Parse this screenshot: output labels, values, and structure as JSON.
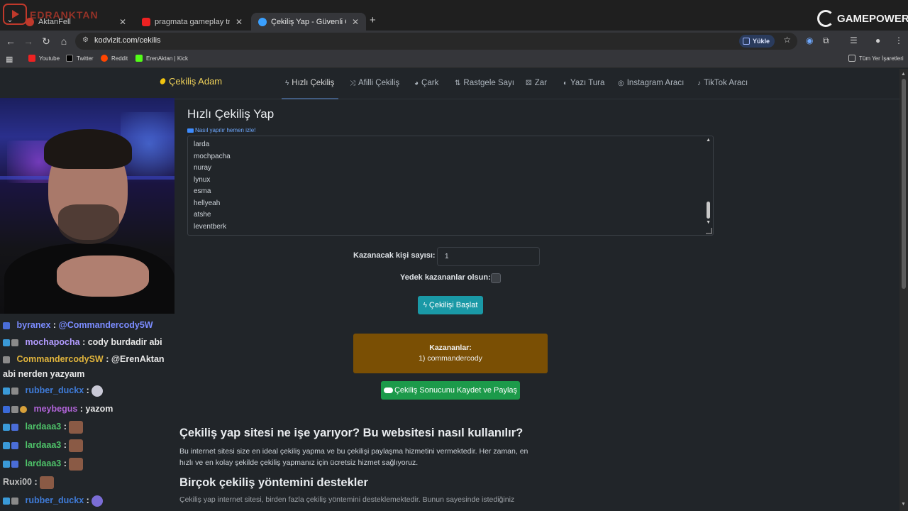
{
  "stream_overlay": {
    "label": "EDRANKTAN"
  },
  "browser": {
    "tabs": [
      {
        "title": "AktanFell",
        "active": false
      },
      {
        "title": "pragmata gameplay trailer - YouTube",
        "active": false
      },
      {
        "title": "Çekiliş Yap - Güvenli Çekiliş - Hızlı",
        "active": true
      }
    ],
    "url": "kodvizit.com/cekilis",
    "upload_label": "Yükle",
    "bookmarks": [
      "Youtube",
      "Twitter",
      "Reddit",
      "ErenAktan | Kick"
    ],
    "all_bookmarks": "Tüm Yer İşaretleri"
  },
  "gamepower_logo": "GAMEPOWER",
  "site": {
    "brand": "Çekiliş Adam",
    "nav": [
      {
        "label": "Hızlı Çekiliş",
        "icon": "bolt-icon"
      },
      {
        "label": "Afilli Çekiliş",
        "icon": "shuffle-icon"
      },
      {
        "label": "Çark",
        "icon": "pie-icon"
      },
      {
        "label": "Rastgele Sayı",
        "icon": "sort-icon"
      },
      {
        "label": "Zar",
        "icon": "dice-icon"
      },
      {
        "label": "Yazı Tura",
        "icon": "coin-icon"
      },
      {
        "label": "Instagram Aracı",
        "icon": "instagram-icon"
      },
      {
        "label": "TikTok Aracı",
        "icon": "tiktok-icon"
      }
    ],
    "title": "Hızlı Çekiliş Yap",
    "howto_link": "Nasıl yapılır hemen izle!",
    "names": [
      "larda",
      "mochpacha",
      "nuray",
      "lynux",
      "esma",
      "hellyeah",
      "atshe",
      "leventberk"
    ],
    "winner_count_label": "Kazanacak kişi sayısı:",
    "winner_count_value": "1",
    "backup_label": "Yedek kazananlar olsun:",
    "start_button": "Çekilişi Başlat",
    "winners_heading": "Kazananlar:",
    "winners": [
      "1) commandercody"
    ],
    "save_button": "Çekiliş Sonucunu Kaydet ve Paylaş",
    "section1_title": "Çekiliş yap sitesi ne işe yarıyor? Bu websitesi nasıl kullanılır?",
    "section1_text": "Bu internet sitesi size en ideal çekiliş yapma ve bu çekilişi paylaşma hizmetini vermektedir. Her zaman, en hızlı ve en kolay şekilde çekiliş yapmanız için ücretsiz hizmet sağlıyoruz.",
    "section2_title": "Birçok çekiliş yöntemini destekler",
    "section2_text": "Çekiliş yap internet sitesi, birden fazla çekiliş yöntemini desteklemektedir. Bunun sayesinde istediğiniz"
  },
  "chat": [
    {
      "user": "byranex",
      "color": "#7b8cff",
      "text": "@Commandercody5W"
    },
    {
      "user": "mochapocha",
      "color": "#b29bff",
      "text": "cody burdadir abi"
    },
    {
      "user": "CommandercodySW",
      "color": "#e0b43c",
      "text": "@ErenAktan abi nerden yazyaım"
    },
    {
      "user": "rubber_duckx",
      "color": "#3f7bd8",
      "text": ""
    },
    {
      "user": "meybegus",
      "color": "#b164d8",
      "text": "yazom"
    },
    {
      "user": "lardaaa3",
      "color": "#4fc46a",
      "text": ""
    },
    {
      "user": "lardaaa3",
      "color": "#4fc46a",
      "text": ""
    },
    {
      "user": "lardaaa3",
      "color": "#4fc46a",
      "text": ""
    },
    {
      "user": "Ruxi00",
      "color": "#c0c0c0",
      "text": ""
    },
    {
      "user": "rubber_duckx",
      "color": "#3f7bd8",
      "text": ""
    }
  ]
}
